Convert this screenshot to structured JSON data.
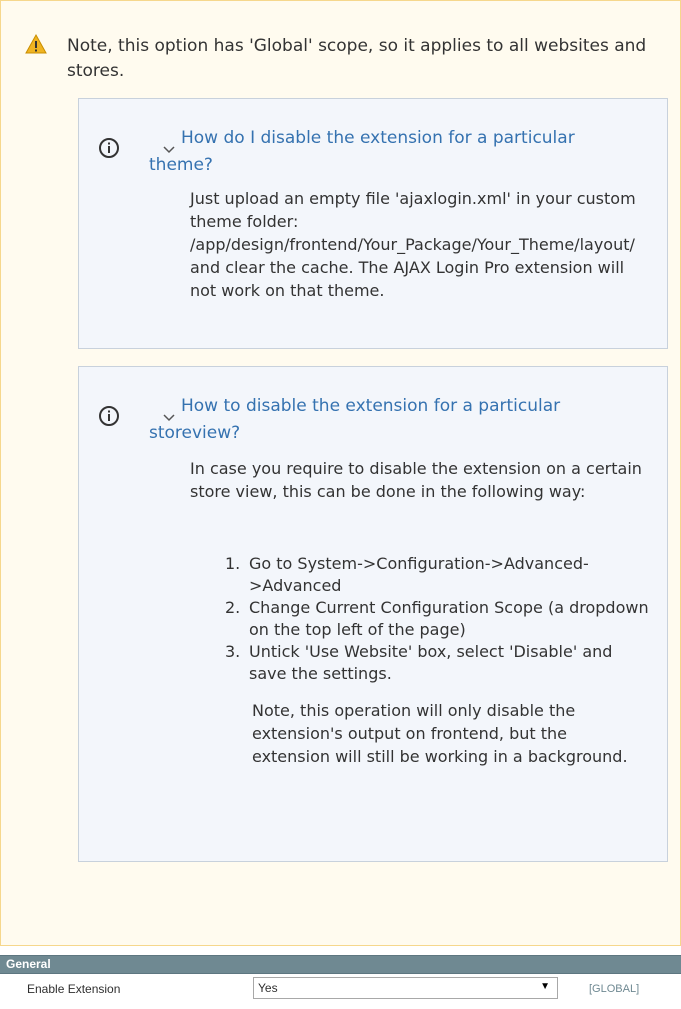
{
  "note": {
    "text": "Note, this option has 'Global' scope, so it applies to all websites and stores.",
    "icon": "warning-icon",
    "accent": "#f0a500"
  },
  "faq": [
    {
      "icon": "info-icon",
      "question": "How do I disable the extension for a particular theme?",
      "answer": "Just upload an empty file 'ajaxlogin.xml' in your custom theme folder: /app/design/frontend/Your_Package/Your_Theme/layout/ and clear the cache. The AJAX Login Pro extension will not work on that theme."
    },
    {
      "icon": "info-icon",
      "question": "How to disable the extension for a particular storeview?",
      "answer": "In case you require to disable the extension on a certain store view, this can be done in the following way:",
      "steps": [
        {
          "num": "1.",
          "text": "Go to System->Configuration->Advanced->Advanced"
        },
        {
          "num": "2.",
          "text": "Change Current Configuration Scope (a dropdown on the top left of the page)"
        },
        {
          "num": "3.",
          "text": "Untick 'Use Website' box, select 'Disable' and save the settings."
        }
      ],
      "note": "Note, this operation will only disable the extension's output on frontend, but the extension will still be working in a background."
    }
  ],
  "config": {
    "section_title": "General",
    "field_label": "Enable Extension",
    "field_value": "Yes",
    "scope": "[GLOBAL]"
  },
  "colors": {
    "link": "#3572b0",
    "header_bg": "#6f8992",
    "panel_bg": "#fffbef"
  }
}
